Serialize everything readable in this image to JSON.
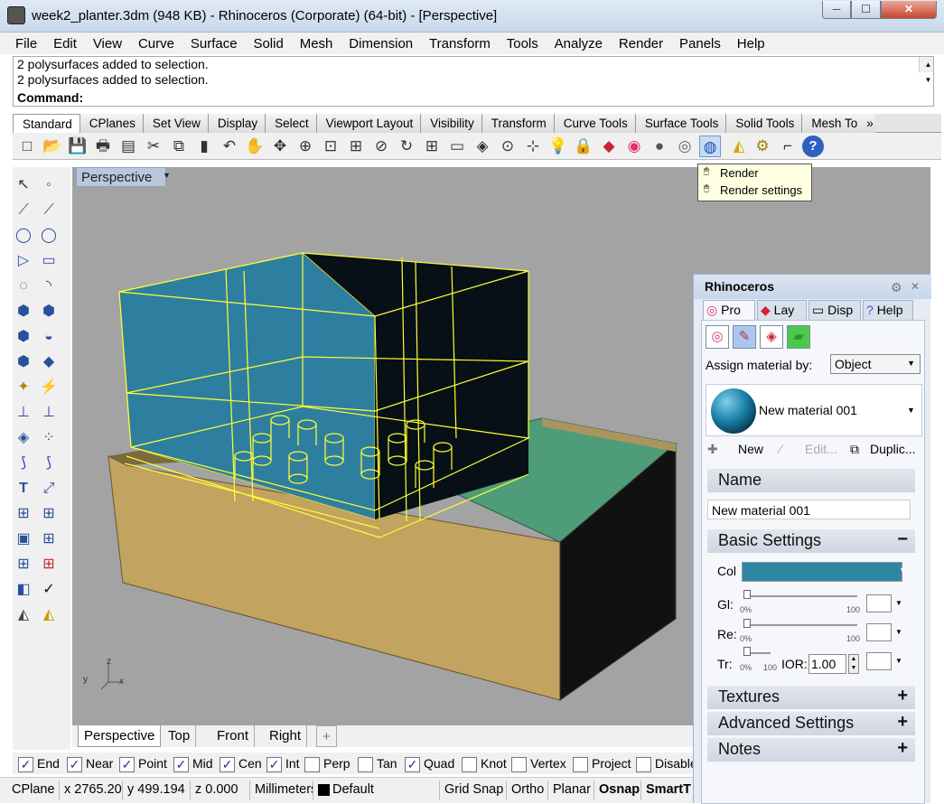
{
  "window": {
    "title": "week2_planter.3dm (948 KB) - Rhinoceros (Corporate) (64-bit) - [Perspective]",
    "min": "─",
    "max": "☐",
    "close": "✕"
  },
  "menu": [
    "File",
    "Edit",
    "View",
    "Curve",
    "Surface",
    "Solid",
    "Mesh",
    "Dimension",
    "Transform",
    "Tools",
    "Analyze",
    "Render",
    "Panels",
    "Help"
  ],
  "history": {
    "lines": [
      "2 polysurfaces added to selection.",
      "2 polysurfaces added to selection."
    ],
    "prompt": "Command:"
  },
  "toolbar_tabs": [
    "Standard",
    "CPlanes",
    "Set View",
    "Display",
    "Select",
    "Viewport Layout",
    "Visibility",
    "Transform",
    "Curve Tools",
    "Surface Tools",
    "Solid Tools",
    "Mesh To"
  ],
  "toolbar_tabs_more": "»",
  "toolbar_icons": [
    "□",
    "📂",
    "💾",
    "🖶",
    "▤",
    "✂",
    "⧉",
    "▮",
    "↶",
    "✋",
    "✥",
    "⊕",
    "⊡",
    "⊞",
    "⊘",
    "↻",
    "⊞",
    "▭",
    "◈",
    "⊙",
    "⊹",
    "💡",
    "🔒",
    "◆",
    "◉",
    "●",
    "◎",
    "◍",
    "◭",
    "⚙",
    "⌐",
    "?"
  ],
  "tooltip": {
    "items": [
      "Render",
      "Render settings"
    ]
  },
  "sidebar_icons": [
    "↖",
    "◦",
    "⟋",
    "⟋",
    "◯",
    "◯",
    "▷",
    "▭",
    "◌",
    "◝",
    "⬢",
    "⬢",
    "⬢",
    "◒",
    "⬢",
    "◆",
    "✦",
    "⚡",
    "⊥",
    "⊥",
    "◈",
    "⁘",
    "⟆",
    "⟆",
    "T",
    "⤢",
    "⊞",
    "⊞",
    "▣",
    "⊞",
    "⊞",
    "⊞",
    "◧",
    "✓",
    "◭",
    "◭"
  ],
  "viewport": {
    "title": "Perspective",
    "axis_x": "x",
    "axis_y": "y",
    "axis_z": "z"
  },
  "viewport_tabs": [
    "Perspective",
    "Top",
    "Front",
    "Right",
    "+"
  ],
  "osnaps": [
    {
      "label": "End",
      "checked": true
    },
    {
      "label": "Near",
      "checked": true
    },
    {
      "label": "Point",
      "checked": true
    },
    {
      "label": "Mid",
      "checked": true
    },
    {
      "label": "Cen",
      "checked": true
    },
    {
      "label": "Int",
      "checked": true
    },
    {
      "label": "Perp",
      "checked": false
    },
    {
      "label": "Tan",
      "checked": false
    },
    {
      "label": "Quad",
      "checked": true
    },
    {
      "label": "Knot",
      "checked": false
    },
    {
      "label": "Vertex",
      "checked": false
    },
    {
      "label": "Project",
      "checked": false
    },
    {
      "label": "Disable",
      "checked": false
    }
  ],
  "status": {
    "cplane": "CPlane",
    "x": "x 2765.20",
    "y": "y 499.194",
    "z": "z 0.000",
    "units": "Millimeters",
    "layer": "Default",
    "grid_snap": "Grid Snap",
    "ortho": "Ortho",
    "planar": "Planar",
    "osnap": "Osnap",
    "smart": "SmartT"
  },
  "panel": {
    "title": "Rhinoceros",
    "tabs": [
      "Pro",
      "Lay",
      "Disp",
      "Help"
    ],
    "assign_label": "Assign material by:",
    "assign_value": "Object",
    "material_name": "New material 001",
    "actions": {
      "new": "New",
      "edit": "Edit...",
      "duplicate": "Duplic..."
    },
    "sections": {
      "name": "Name",
      "basic": "Basic Settings",
      "textures": "Textures",
      "advanced": "Advanced Settings",
      "notes": "Notes"
    },
    "name_value": "New material 001",
    "color_label": "Col",
    "color_value": "#2f86a3",
    "gloss_label": "Gl:",
    "refl_label": "Re:",
    "trans_label": "Tr:",
    "slider_min": "0%",
    "slider_max": "100",
    "ior_label": "IOR:",
    "ior_value": "1.00"
  }
}
